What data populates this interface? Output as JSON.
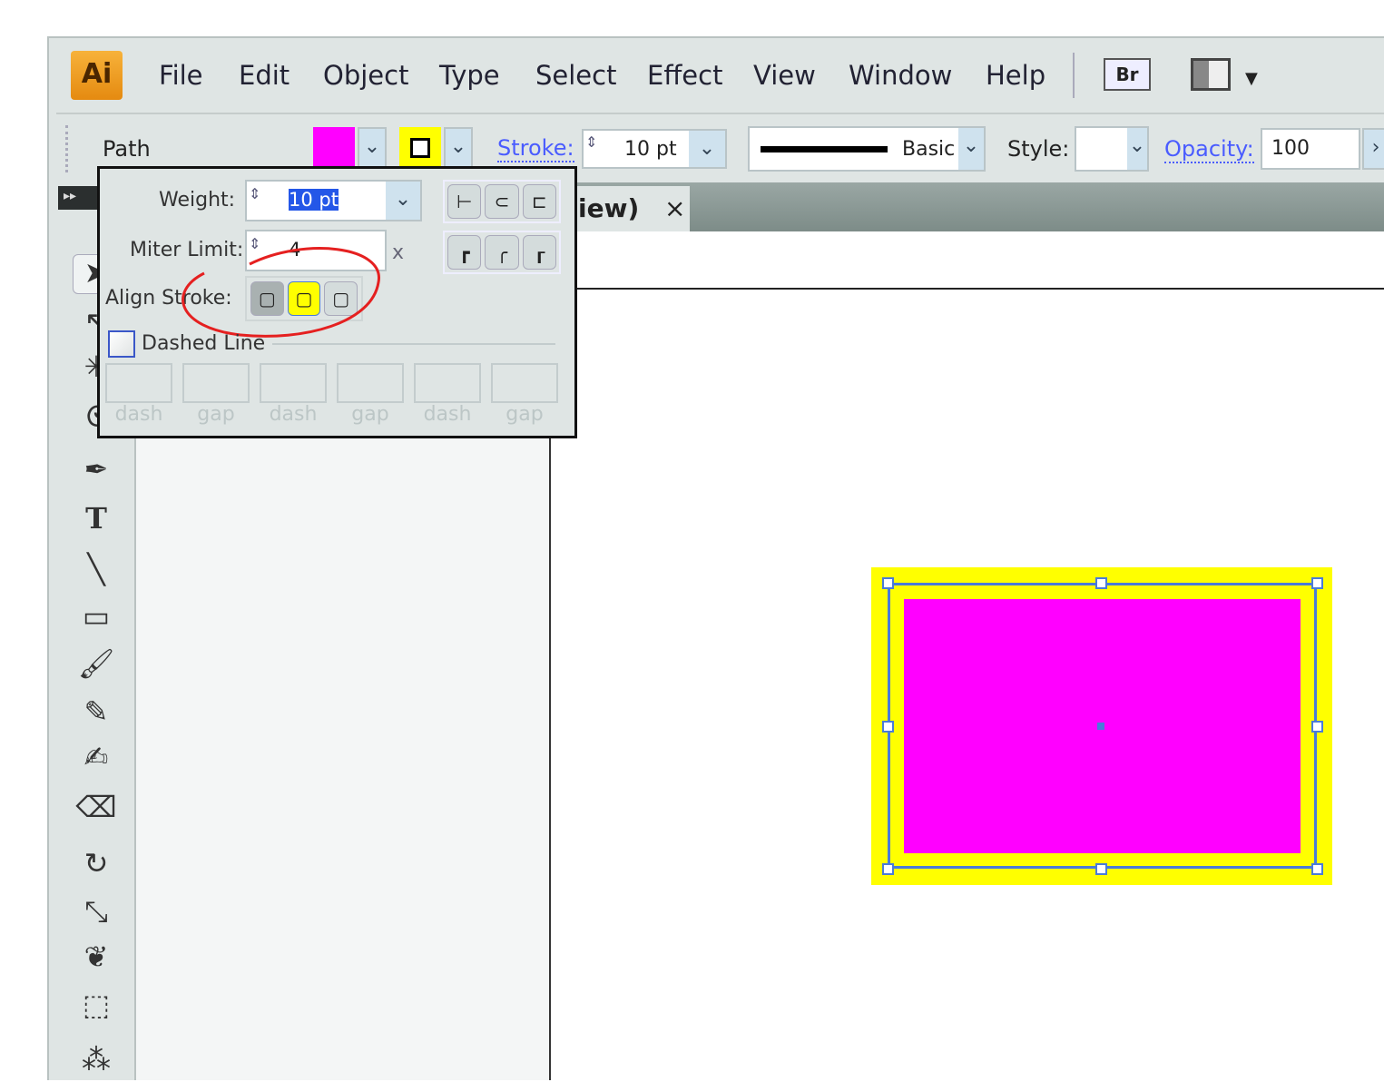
{
  "app": {
    "logo": "Ai"
  },
  "menu": [
    "File",
    "Edit",
    "Object",
    "Type",
    "Select",
    "Effect",
    "View",
    "Window",
    "Help"
  ],
  "menu_icons": {
    "bridge": "Br",
    "workspace": "workspace-layout-icon"
  },
  "control": {
    "object_type": "Path",
    "stroke_label": "Stroke:",
    "stroke_value": "10 pt",
    "brush_label": "Basic",
    "style_label": "Style:",
    "opacity_label": "Opacity:",
    "opacity_value": "100"
  },
  "colors": {
    "fill": "#ff00ff",
    "stroke": "#ffff00",
    "selection": "#4a7bd8"
  },
  "doc_tab": {
    "title": "iew)",
    "close": "×"
  },
  "stroke_panel": {
    "weight_label": "Weight:",
    "weight_value": "10 pt",
    "miter_label": "Miter Limit:",
    "miter_value": "4",
    "miter_unit": "x",
    "align_label": "Align Stroke:",
    "dashed_label": "Dashed Line",
    "dash_labels": [
      "dash",
      "gap",
      "dash",
      "gap",
      "dash",
      "gap"
    ]
  }
}
